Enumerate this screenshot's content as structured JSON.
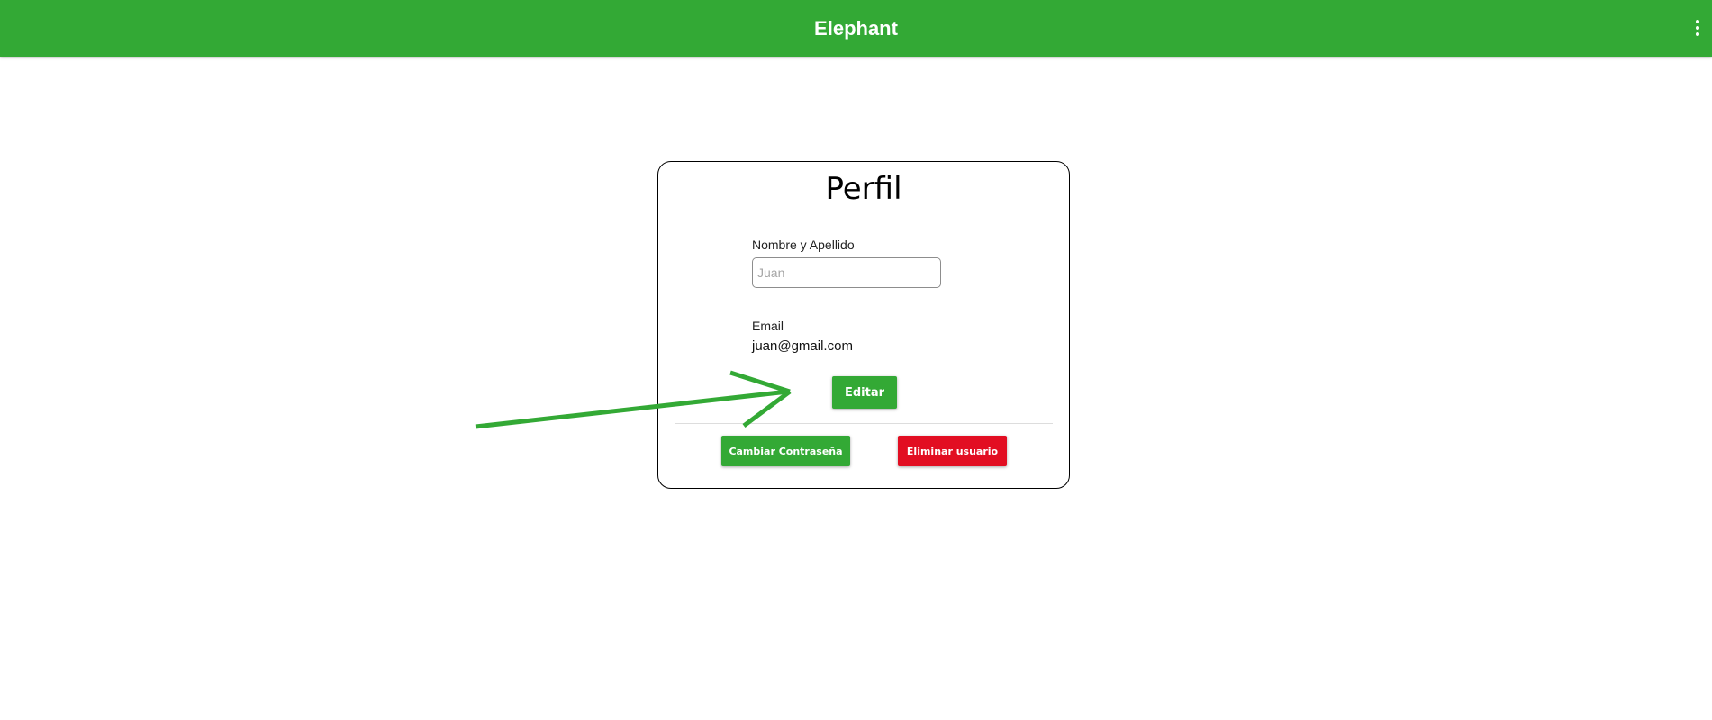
{
  "header": {
    "title": "Elephant",
    "menu_icon": "more-vert-icon",
    "color": "#33a935"
  },
  "profile": {
    "title": "Perfil",
    "name_label": "Nombre y Apellido",
    "name_placeholder": "Juan",
    "name_value": "",
    "email_label": "Email",
    "email_value": "juan@gmail.com",
    "edit_label": "Editar",
    "change_password_label": "Cambiar Contraseña",
    "delete_user_label": "Eliminar usuario"
  },
  "colors": {
    "primary": "#33a935",
    "danger": "#e20e22",
    "annotation_arrow": "#33a935"
  }
}
